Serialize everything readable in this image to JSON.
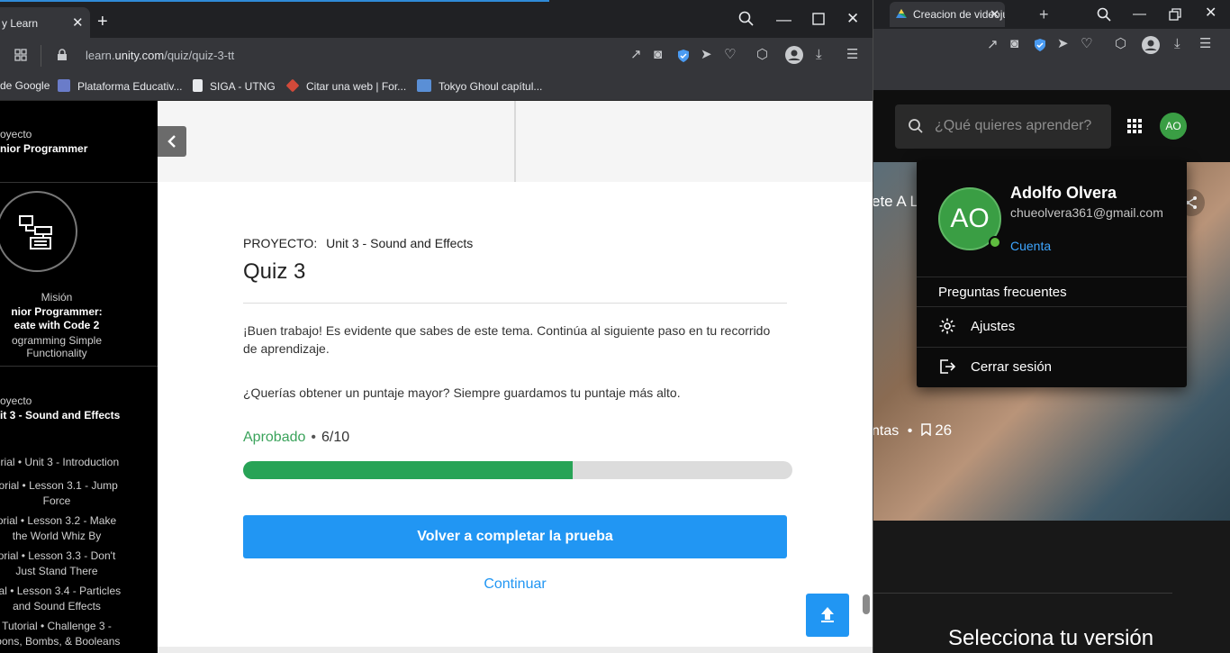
{
  "left_window": {
    "tab_title": "y Learn",
    "url_prefix": "learn.",
    "url_domain": "unity.com",
    "url_path": "/quiz/quiz-3-tt",
    "bookmarks": [
      {
        "label": "de Google"
      },
      {
        "label": "Plataforma Educativ..."
      },
      {
        "label": "SIGA - UTNG"
      },
      {
        "label": "Citar una web | For..."
      },
      {
        "label": "Tokyo Ghoul capítul..."
      }
    ]
  },
  "sidebar": {
    "project_kicker": "oyecto",
    "project_name": "nior Programmer",
    "mission_kicker": "Misión",
    "mission_name_1": "nior Programmer:",
    "mission_name_2": "eate with Code 2",
    "mission_desc_1": "ogramming Simple",
    "mission_desc_2": "Functionality",
    "unit_kicker": "oyecto",
    "unit_name": "it 3 - Sound and Effects",
    "tutorials": [
      {
        "l1": "orial • Unit 3 - Introduction",
        "l2": ""
      },
      {
        "l1": "torial • Lesson 3.1 - Jump",
        "l2": "Force"
      },
      {
        "l1": "orial • Lesson 3.2 - Make",
        "l2": "the World Whiz By"
      },
      {
        "l1": "orial • Lesson 3.3 - Don't",
        "l2": "Just Stand There"
      },
      {
        "l1": "rial • Lesson 3.4 - Particles",
        "l2": "and Sound Effects"
      },
      {
        "l1": "Tutorial • Challenge 3 -",
        "l2": "loons, Bombs, & Booleans"
      }
    ]
  },
  "quiz": {
    "project_label": "PROYECTO:",
    "project_name": "Unit 3 - Sound and Effects",
    "title": "Quiz 3",
    "message_1": "¡Buen trabajo! Es evidente que sabes de este tema. Continúa al siguiente paso en tu recorrido de aprendizaje.",
    "message_2": "¿Querías obtener un puntaje mayor? Siempre guardamos tu puntaje más alto.",
    "status": "Aprobado",
    "status_dot": "•",
    "score": "6/10",
    "progress": 0.6,
    "retake_label": "Volver a completar la prueba",
    "continue_label": "Continuar"
  },
  "right_window": {
    "tab_title": "Creacion de videoju",
    "search_placeholder": "¿Qué quieres aprender?",
    "avatar_initials": "AO",
    "hero_title_fragment": "ete A L",
    "hero_meta_prefix": "ntas",
    "hero_meta_dot": "•",
    "hero_meta_count": "26",
    "version_title": "Selecciona tu versión"
  },
  "account_menu": {
    "initials": "AO",
    "name": "Adolfo Olvera",
    "email": "chueolvera361@gmail.com",
    "account_link": "Cuenta",
    "faq": "Preguntas frecuentes",
    "settings": "Ajustes",
    "logout": "Cerrar sesión"
  },
  "colors": {
    "accent_blue": "#2196f3",
    "pass_green": "#27a356",
    "avatar_green": "#3a9e44"
  }
}
